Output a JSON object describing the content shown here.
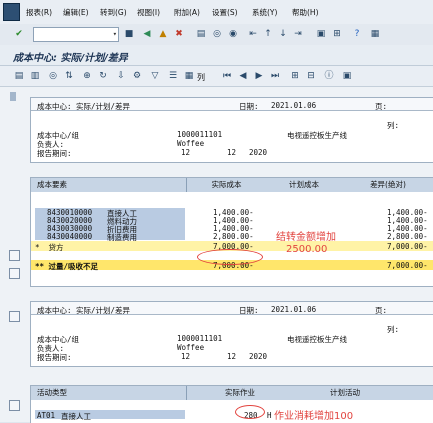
{
  "menu": [
    "报表(R)",
    "编辑(E)",
    "转到(G)",
    "视图(I)",
    "附加(A)",
    "设置(S)",
    "系统(Y)",
    "帮助(H)"
  ],
  "toolbar_icons": [
    "check-icon",
    "save-icon",
    "back-icon",
    "exit-icon",
    "cancel-icon",
    "print-icon",
    "find-icon",
    "find-next-icon",
    "first-page-icon",
    "prev-page-icon",
    "next-page-icon",
    "last-page-icon",
    "create-session-icon",
    "shortcut-icon",
    "help-icon",
    "layout-icon"
  ],
  "window_title": "成本中心: 实际/计划/差异",
  "app_toolbar_label": "列",
  "report1": {
    "header_title": "成本中心: 实际/计划/差异",
    "date_label": "日期:",
    "date": "2021.01.06",
    "page_label": "页:",
    "col_label": "列:",
    "cc_label": "成本中心/组",
    "cc_value": "1000011101",
    "cc_desc": "电视遥控板生产线",
    "resp_label": "负责人:",
    "resp_value": "Woffee",
    "period_label": "报告期间:",
    "period_from": "12",
    "period_to": "12",
    "year": "2020",
    "columns": [
      "成本要素",
      "实际成本",
      "计划成本",
      "差异(绝对)"
    ],
    "rows": [
      {
        "code": "8430010000",
        "name": "直接人工",
        "actual": "1,400.00-",
        "var": "1,400.00-"
      },
      {
        "code": "8430020000",
        "name": "燃料动力",
        "actual": "1,400.00-",
        "var": "1,400.00-"
      },
      {
        "code": "8430030000",
        "name": "折旧费用",
        "actual": "1,400.00-",
        "var": "1,400.00-"
      },
      {
        "code": "8430040000",
        "name": "制造费用",
        "actual": "2,800.00-",
        "var": "2,800.00-"
      }
    ],
    "credit_label": "*  贷方",
    "credit_actual": "7,000.00-",
    "credit_var": "7,000.00-",
    "total_label": "** 过量/吸收不足",
    "total_actual": "7,000.00-",
    "total_var": "7,000.00-"
  },
  "note1_line1": "结转金额增加",
  "note1_line2": "2500.00",
  "report2": {
    "header_title": "成本中心: 实际/计划/差异",
    "date_label": "日期:",
    "date": "2021.01.06",
    "page_label": "页:",
    "col_label": "列:",
    "cc_label": "成本中心/组",
    "cc_value": "1000011101",
    "cc_desc": "电视遥控板生产线",
    "resp_label": "负责人:",
    "resp_value": "Woffee",
    "period_label": "报告期间:",
    "period_from": "12",
    "period_to": "12",
    "year": "2020",
    "columns": [
      "活动类型",
      "实际作业",
      "计划活动"
    ],
    "row_code": "AT01",
    "row_name": "直接人工",
    "row_qty": "280",
    "row_unit": "H"
  },
  "note2": "作业消耗增加100"
}
